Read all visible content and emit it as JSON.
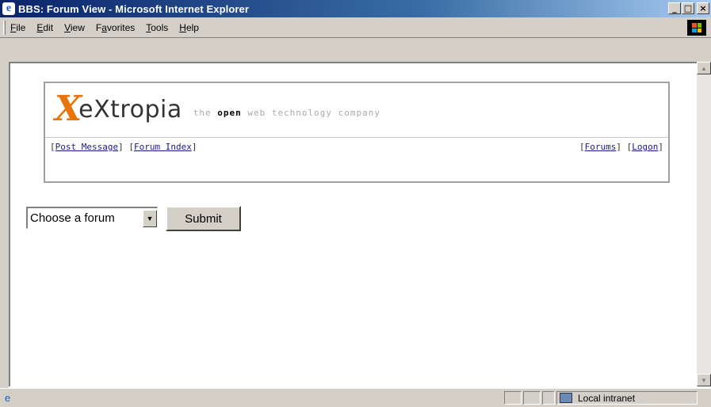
{
  "window": {
    "title": "BBS: Forum View - Microsoft Internet Explorer",
    "minimize": "_",
    "maximize": "□",
    "close": "×"
  },
  "menubar": {
    "items": [
      {
        "label": "File",
        "key": "F",
        "rest": "ile"
      },
      {
        "label": "Edit",
        "key": "E",
        "rest": "dit"
      },
      {
        "label": "View",
        "key": "V",
        "rest": "iew"
      },
      {
        "label": "Favorites",
        "pre": "F",
        "key": "a",
        "rest": "vorites"
      },
      {
        "label": "Tools",
        "key": "T",
        "rest": "ools"
      },
      {
        "label": "Help",
        "key": "H",
        "rest": "elp"
      }
    ]
  },
  "header": {
    "logo_mark": "X",
    "logo_word": "eXtropia",
    "tagline_pre": "the ",
    "tagline_bold": "open",
    "tagline_post": " web technology company",
    "nav_left": [
      {
        "label": "Post Message"
      },
      {
        "label": "Forum Index"
      }
    ],
    "nav_right": [
      {
        "label": "Forums"
      },
      {
        "label": "Logon"
      }
    ]
  },
  "form": {
    "select_value": "Choose a forum",
    "submit_label": "Submit"
  },
  "statusbar": {
    "zone_label": "Local intranet"
  },
  "colors": {
    "title_gradient_start": "#0a246a",
    "chrome": "#d4d0c8",
    "logo_accent": "#e8740c",
    "link": "#1a1a88"
  }
}
